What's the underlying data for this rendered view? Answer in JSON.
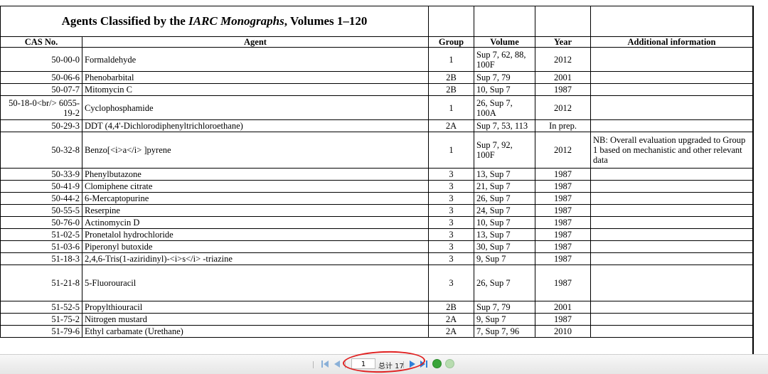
{
  "table": {
    "title_prefix": "Agents Classified by the ",
    "title_italic": "IARC Monographs",
    "title_suffix": ", Volumes 1–120",
    "headers": {
      "cas": "CAS No.",
      "agent": "Agent",
      "group": "Group",
      "volume": "Volume",
      "year": "Year",
      "info": "Additional information"
    },
    "rows": [
      {
        "cas": "50-00-0",
        "agent": "Formaldehyde",
        "group": "1",
        "volume": "Sup 7, 62, 88, 100F",
        "year": "2012",
        "info": ""
      },
      {
        "cas": "50-06-6",
        "agent": "Phenobarbital",
        "group": "2B",
        "volume": "Sup 7, 79",
        "year": "2001",
        "info": ""
      },
      {
        "cas": "50-07-7",
        "agent": "Mitomycin C",
        "group": "2B",
        "volume": "10, Sup 7",
        "year": "1987",
        "info": ""
      },
      {
        "cas": "50-18-0<br/> 6055-19-2",
        "agent": "Cyclophosphamide",
        "group": "1",
        "volume": "26, Sup 7, 100A",
        "year": "2012",
        "info": ""
      },
      {
        "cas": "50-29-3",
        "agent": "DDT (4,4'-Dichlorodiphenyltrichloroethane)",
        "group": "2A",
        "volume": "Sup 7, 53, 113",
        "year": "In prep.",
        "info": ""
      },
      {
        "cas": "50-32-8",
        "agent": "Benzo[<i>a</i> ]pyrene",
        "group": "1",
        "volume": "Sup 7, 92, 100F",
        "year": "2012",
        "info": "NB: Overall evaluation upgraded to Group 1 based on mechanistic and other relevant data"
      },
      {
        "cas": "50-33-9",
        "agent": "Phenylbutazone",
        "group": "3",
        "volume": "13, Sup 7",
        "year": "1987",
        "info": ""
      },
      {
        "cas": "50-41-9",
        "agent": "Clomiphene citrate",
        "group": "3",
        "volume": "21, Sup 7",
        "year": "1987",
        "info": ""
      },
      {
        "cas": "50-44-2",
        "agent": "6-Mercaptopurine",
        "group": "3",
        "volume": "26, Sup 7",
        "year": "1987",
        "info": ""
      },
      {
        "cas": "50-55-5",
        "agent": "Reserpine",
        "group": "3",
        "volume": "24, Sup 7",
        "year": "1987",
        "info": ""
      },
      {
        "cas": "50-76-0",
        "agent": "Actinomycin D",
        "group": "3",
        "volume": "10, Sup 7",
        "year": "1987",
        "info": ""
      },
      {
        "cas": "51-02-5",
        "agent": "Pronetalol hydrochloride",
        "group": "3",
        "volume": "13, Sup 7",
        "year": "1987",
        "info": ""
      },
      {
        "cas": "51-03-6",
        "agent": "Piperonyl butoxide",
        "group": "3",
        "volume": "30, Sup 7",
        "year": "1987",
        "info": ""
      },
      {
        "cas": "51-18-3",
        "agent": "2,4,6-Tris(1-aziridinyl)-<i>s</i> -triazine",
        "group": "3",
        "volume": "9, Sup 7",
        "year": "1987",
        "info": ""
      },
      {
        "cas": "51-21-8",
        "agent": "5-Fluorouracil",
        "group": "3",
        "volume": "26, Sup 7",
        "year": "1987",
        "info": ""
      },
      {
        "cas": "51-52-5",
        "agent": "Propylthiouracil",
        "group": "2B",
        "volume": "Sup 7, 79",
        "year": "2001",
        "info": ""
      },
      {
        "cas": "51-75-2",
        "agent": "Nitrogen mustard",
        "group": "2A",
        "volume": "9, Sup 7",
        "year": "1987",
        "info": ""
      },
      {
        "cas": "51-79-6",
        "agent": "Ethyl carbamate (Urethane)",
        "group": "2A",
        "volume": "7, Sup 7, 96",
        "year": "2010",
        "info": ""
      }
    ]
  },
  "pager": {
    "current_page": "1",
    "total_label": "总计 17"
  },
  "colors": {
    "annotation_circle": "#e02020",
    "nav_blue": "#2f7fd8",
    "nav_green": "#3aa53a"
  },
  "icons": [
    "first-page-icon",
    "prev-page-icon",
    "next-page-icon",
    "last-page-icon",
    "refresh-icon",
    "forward-circle-icon"
  ]
}
